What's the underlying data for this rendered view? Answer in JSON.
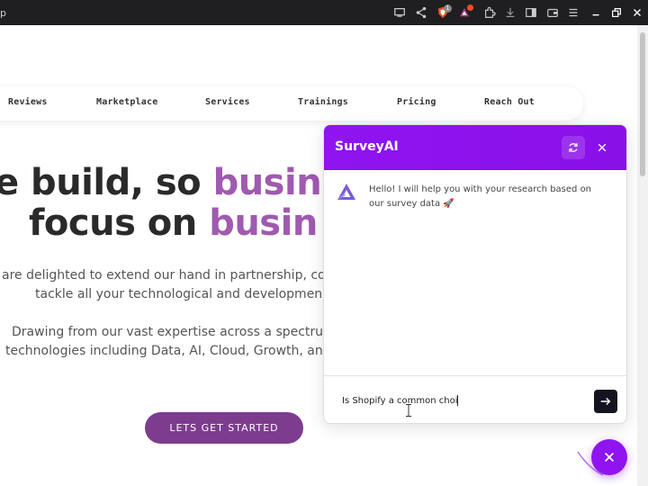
{
  "browser": {
    "tab_fragment": "p",
    "icons": [
      "cast-icon",
      "share-icon",
      "brave-shield-icon",
      "brave-rewards-icon",
      "extensions-icon",
      "download-icon",
      "sidebar-icon",
      "wallet-icon",
      "menu-icon",
      "minimize-icon",
      "restore-icon",
      "close-window-icon"
    ],
    "brave_shield_count": "1"
  },
  "nav": {
    "items": [
      "Reviews",
      "Marketplace",
      "Services",
      "Trainings",
      "Pricing",
      "Reach Out"
    ]
  },
  "hero": {
    "line1_plain": "e build, so ",
    "line1_accent": "busin",
    "line2_plain": "focus on ",
    "line2_accent": "busin",
    "para1_line1": "are delighted to extend our hand in partnership, co",
    "para1_line2": "tackle all your technological and developmen",
    "para2_line1": "Drawing from our vast expertise across a spectrun",
    "para2_line2": "technologies including Data, AI, Cloud, Growth, an",
    "cta_label": "LETS GET STARTED"
  },
  "chat": {
    "title": "SurveyAI",
    "message": "Hello! I will help you with your research based on our survey data 🚀",
    "input_value": "Is Shopify a common choi",
    "accent_color": "#8f14f0"
  }
}
